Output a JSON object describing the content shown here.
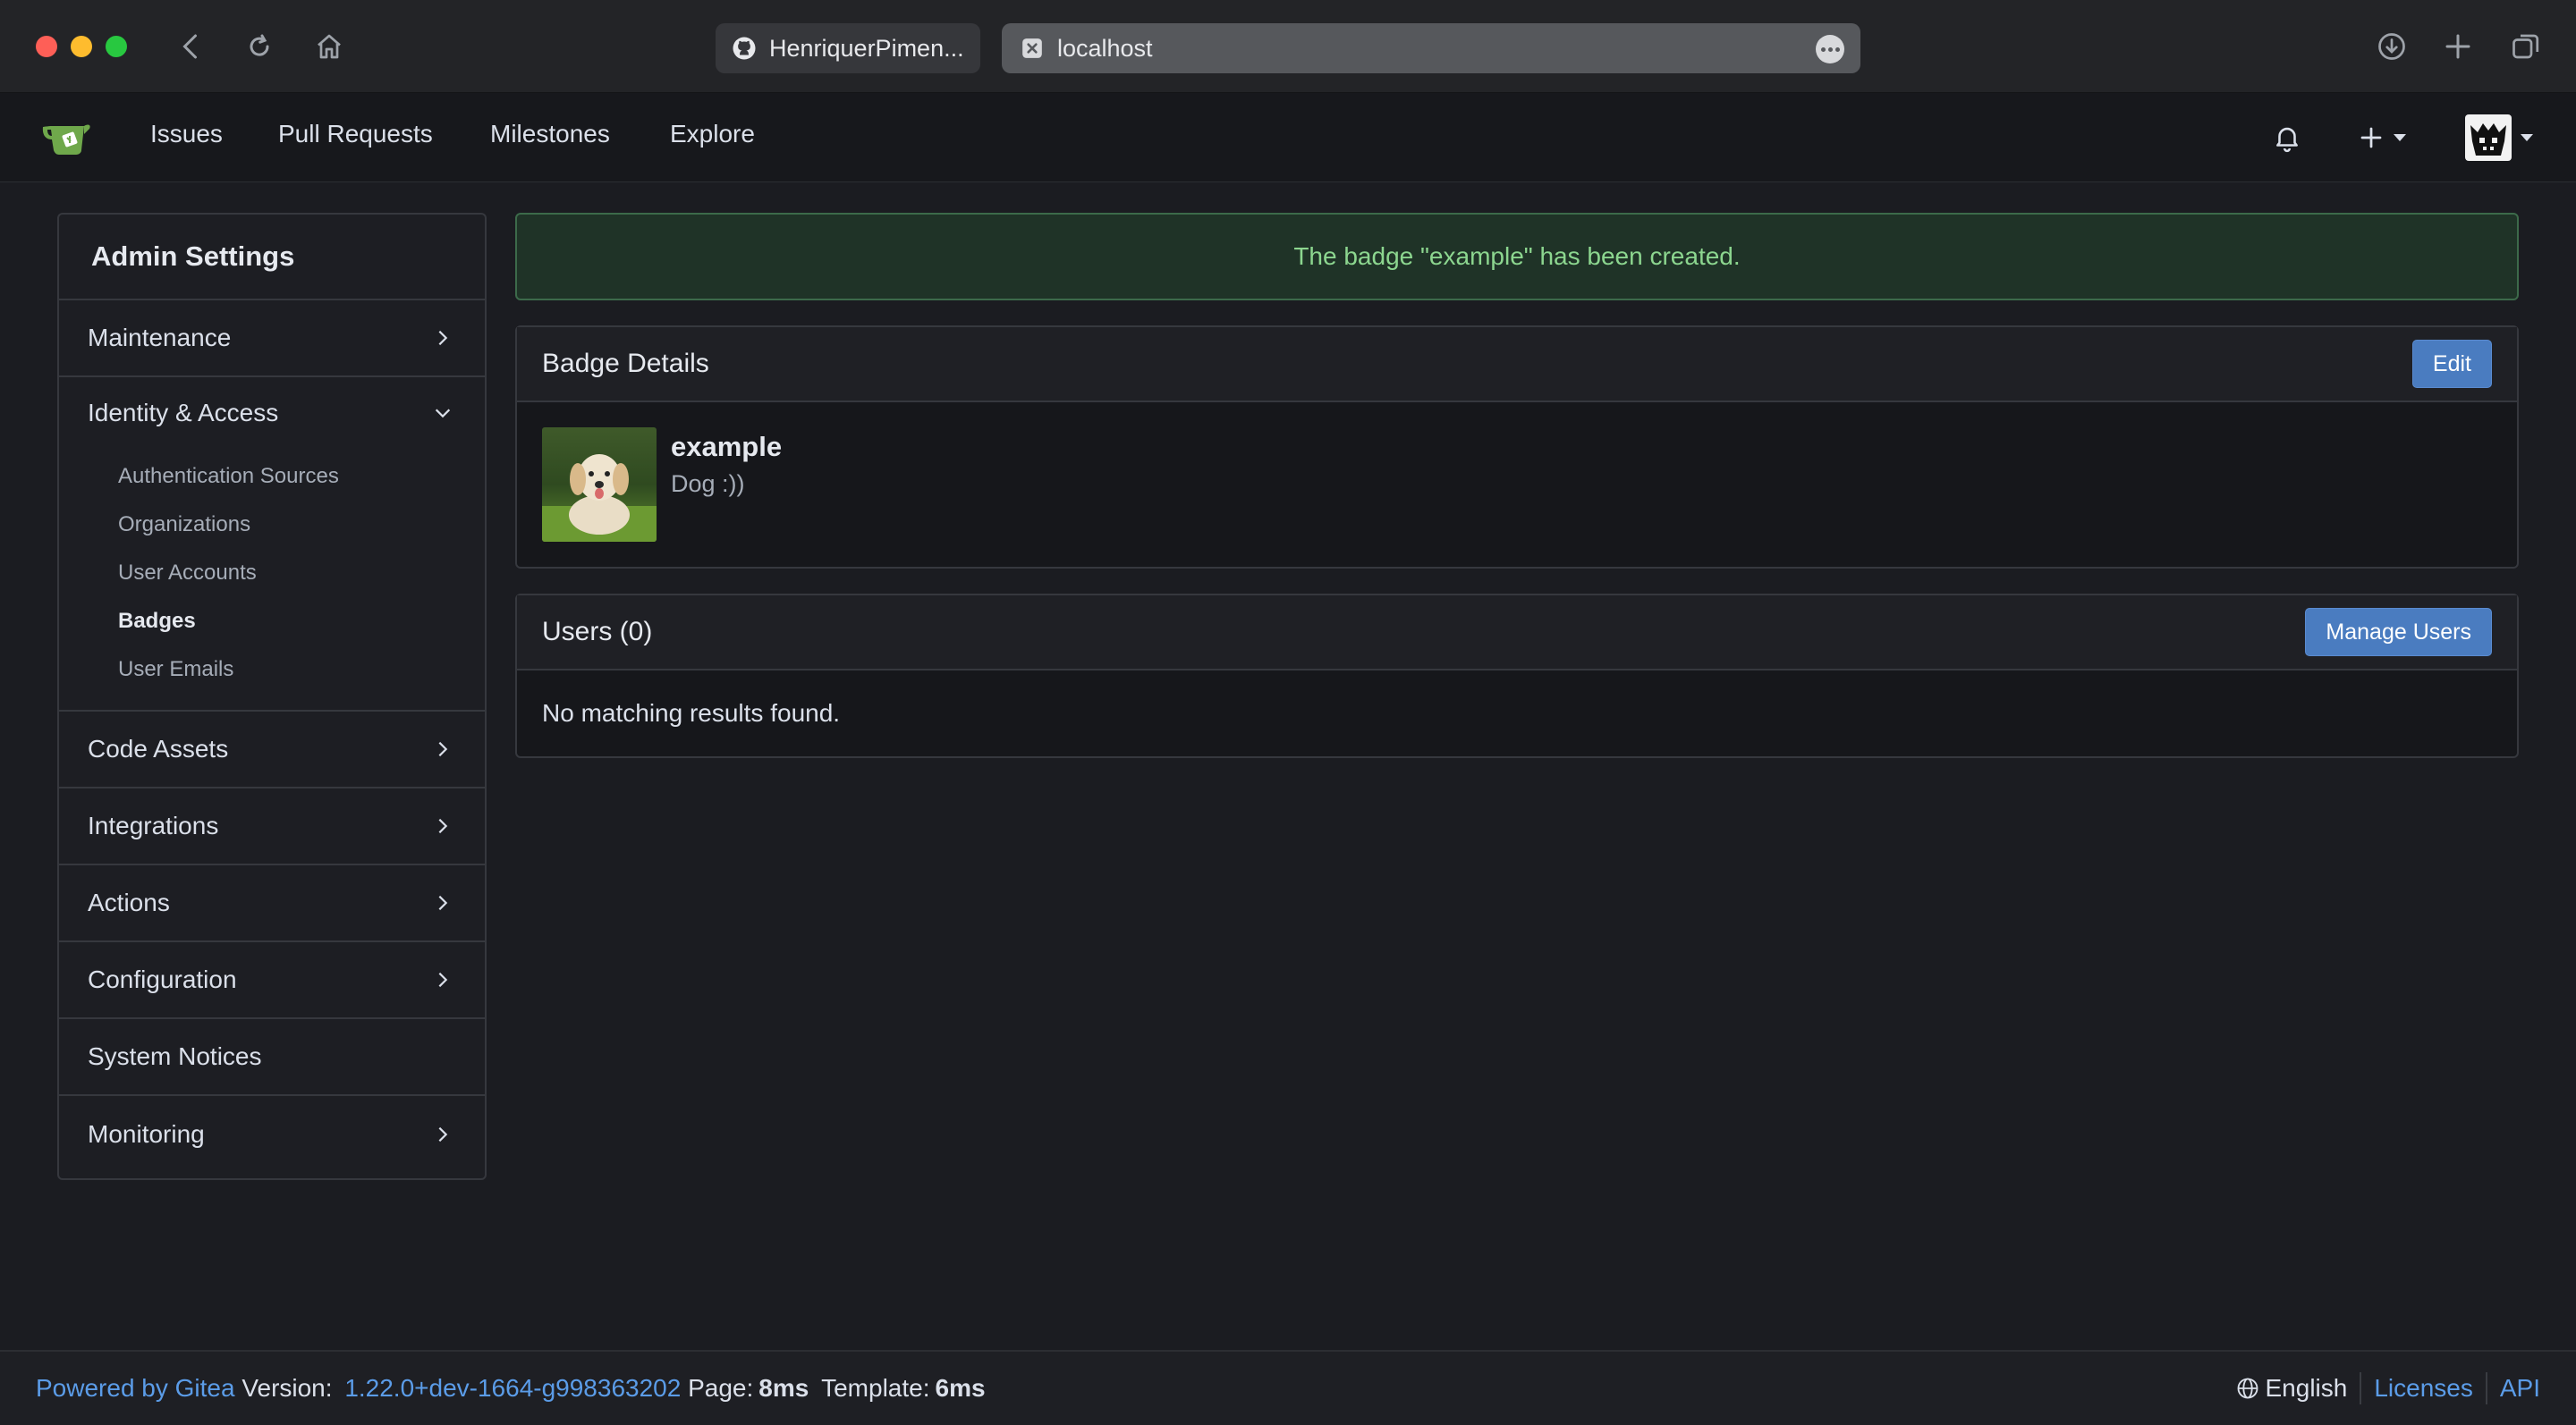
{
  "browser": {
    "tabs": [
      {
        "label": "HenriquerPimen...",
        "icon": "github-icon"
      },
      {
        "label": "localhost",
        "icon": "close-tab-icon"
      }
    ],
    "colors": {
      "traffic_red": "#fe5f57",
      "traffic_yellow": "#febc2e",
      "traffic_green": "#28c840"
    }
  },
  "navbar": {
    "items": [
      "Issues",
      "Pull Requests",
      "Milestones",
      "Explore"
    ]
  },
  "sidebar": {
    "title": "Admin Settings",
    "items": [
      {
        "label": "Maintenance"
      },
      {
        "label": "Identity & Access",
        "open": true,
        "children": [
          "Authentication Sources",
          "Organizations",
          "User Accounts",
          "Badges",
          "User Emails"
        ],
        "active_child": "Badges"
      },
      {
        "label": "Code Assets"
      },
      {
        "label": "Integrations"
      },
      {
        "label": "Actions"
      },
      {
        "label": "Configuration"
      },
      {
        "label": "System Notices"
      },
      {
        "label": "Monitoring"
      }
    ]
  },
  "flash": {
    "message": "The badge \"example\" has been created.",
    "color": "#8cd68f"
  },
  "badge_panel": {
    "title": "Badge Details",
    "edit_label": "Edit",
    "name": "example",
    "description": "Dog :))"
  },
  "users_panel": {
    "title": "Users (0)",
    "manage_label": "Manage Users",
    "empty_text": "No matching results found."
  },
  "footer": {
    "powered_by": "Powered by Gitea",
    "version_label": "Version:",
    "version": "1.22.0+dev-1664-g998363202",
    "page_label": "Page:",
    "page_time": "8ms",
    "template_label": "Template:",
    "template_time": "6ms",
    "language": "English",
    "licenses": "Licenses",
    "api": "API"
  },
  "accent_color": "#4a7cc0"
}
